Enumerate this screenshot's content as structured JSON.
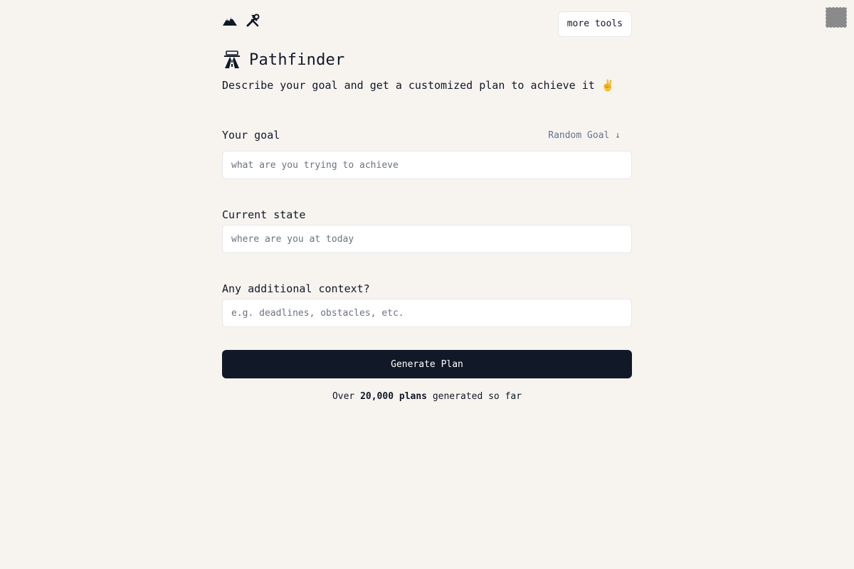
{
  "header": {
    "icons": [
      "mountain-icon",
      "tools-icon"
    ],
    "more_tools_label": "more tools"
  },
  "hero": {
    "title": "Pathfinder",
    "subtitle": "Describe your goal and get a customized plan to achieve it ✌️"
  },
  "form": {
    "goal": {
      "label": "Your goal",
      "placeholder": "what are you trying to achieve",
      "value": "",
      "random_label": "Random Goal ↓"
    },
    "current_state": {
      "label": "Current state",
      "placeholder": "where are you at today",
      "value": ""
    },
    "context": {
      "label": "Any additional context?",
      "placeholder": "e.g. deadlines, obstacles, etc.",
      "value": ""
    },
    "submit_label": "Generate Plan"
  },
  "stats": {
    "prefix": "Over ",
    "count": "20,000 plans",
    "suffix": " generated so far"
  },
  "colors": {
    "background": "#f7f4f0",
    "primary": "#111827",
    "muted": "#64748b",
    "border": "#e5e7eb"
  }
}
